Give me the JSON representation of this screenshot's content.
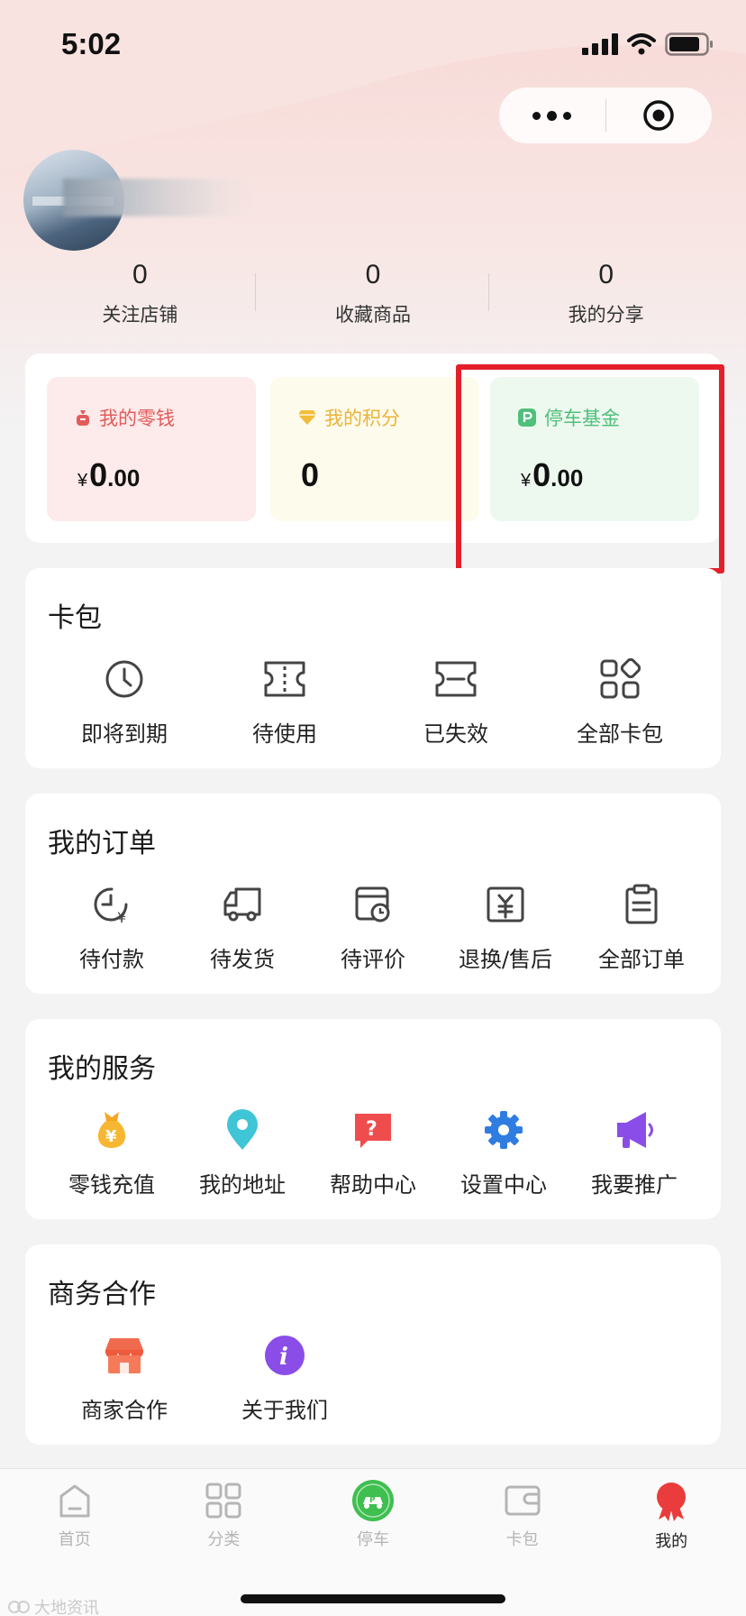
{
  "status": {
    "time": "5:02"
  },
  "stats": [
    {
      "value": "0",
      "label": "关注店铺"
    },
    {
      "value": "0",
      "label": "收藏商品"
    },
    {
      "value": "0",
      "label": "我的分享"
    }
  ],
  "wallet": {
    "change": {
      "label": "我的零钱",
      "currency": "¥",
      "int": "0",
      "dec": ".00"
    },
    "points": {
      "label": "我的积分",
      "value": "0"
    },
    "parking_fund": {
      "label": "停车基金",
      "currency": "¥",
      "int": "0",
      "dec": ".00"
    }
  },
  "card_pack": {
    "title": "卡包",
    "items": [
      {
        "label": "即将到期",
        "icon": "clock-icon"
      },
      {
        "label": "待使用",
        "icon": "ticket-icon"
      },
      {
        "label": "已失效",
        "icon": "expired-ticket-icon"
      },
      {
        "label": "全部卡包",
        "icon": "grid-icon"
      }
    ]
  },
  "orders": {
    "title": "我的订单",
    "items": [
      {
        "label": "待付款",
        "icon": "pending-payment-icon"
      },
      {
        "label": "待发货",
        "icon": "truck-icon"
      },
      {
        "label": "待评价",
        "icon": "review-icon"
      },
      {
        "label": "退换/售后",
        "icon": "refund-icon"
      },
      {
        "label": "全部订单",
        "icon": "clipboard-icon"
      }
    ]
  },
  "services": {
    "title": "我的服务",
    "items": [
      {
        "label": "零钱充值",
        "icon": "money-bag-icon"
      },
      {
        "label": "我的地址",
        "icon": "location-pin-icon"
      },
      {
        "label": "帮助中心",
        "icon": "help-icon"
      },
      {
        "label": "设置中心",
        "icon": "gear-icon"
      },
      {
        "label": "我要推广",
        "icon": "megaphone-icon"
      }
    ]
  },
  "business": {
    "title": "商务合作",
    "items": [
      {
        "label": "商家合作",
        "icon": "store-icon"
      },
      {
        "label": "关于我们",
        "icon": "info-icon"
      }
    ]
  },
  "tabbar": {
    "items": [
      {
        "label": "首页",
        "icon": "home-icon"
      },
      {
        "label": "分类",
        "icon": "category-icon"
      },
      {
        "label": "停车",
        "icon": "parking-icon"
      },
      {
        "label": "卡包",
        "icon": "wallet-icon"
      },
      {
        "label": "我的",
        "icon": "profile-icon"
      }
    ],
    "active": "我的"
  },
  "watermark": "大地资讯",
  "colors": {
    "highlight": "#e3202a",
    "change": "#e25b5b",
    "points": "#e9b33a",
    "parking_fund": "#4fbf7c",
    "parking_tab": "#3fbf4f",
    "profile_tab": "#ea3c3c"
  }
}
